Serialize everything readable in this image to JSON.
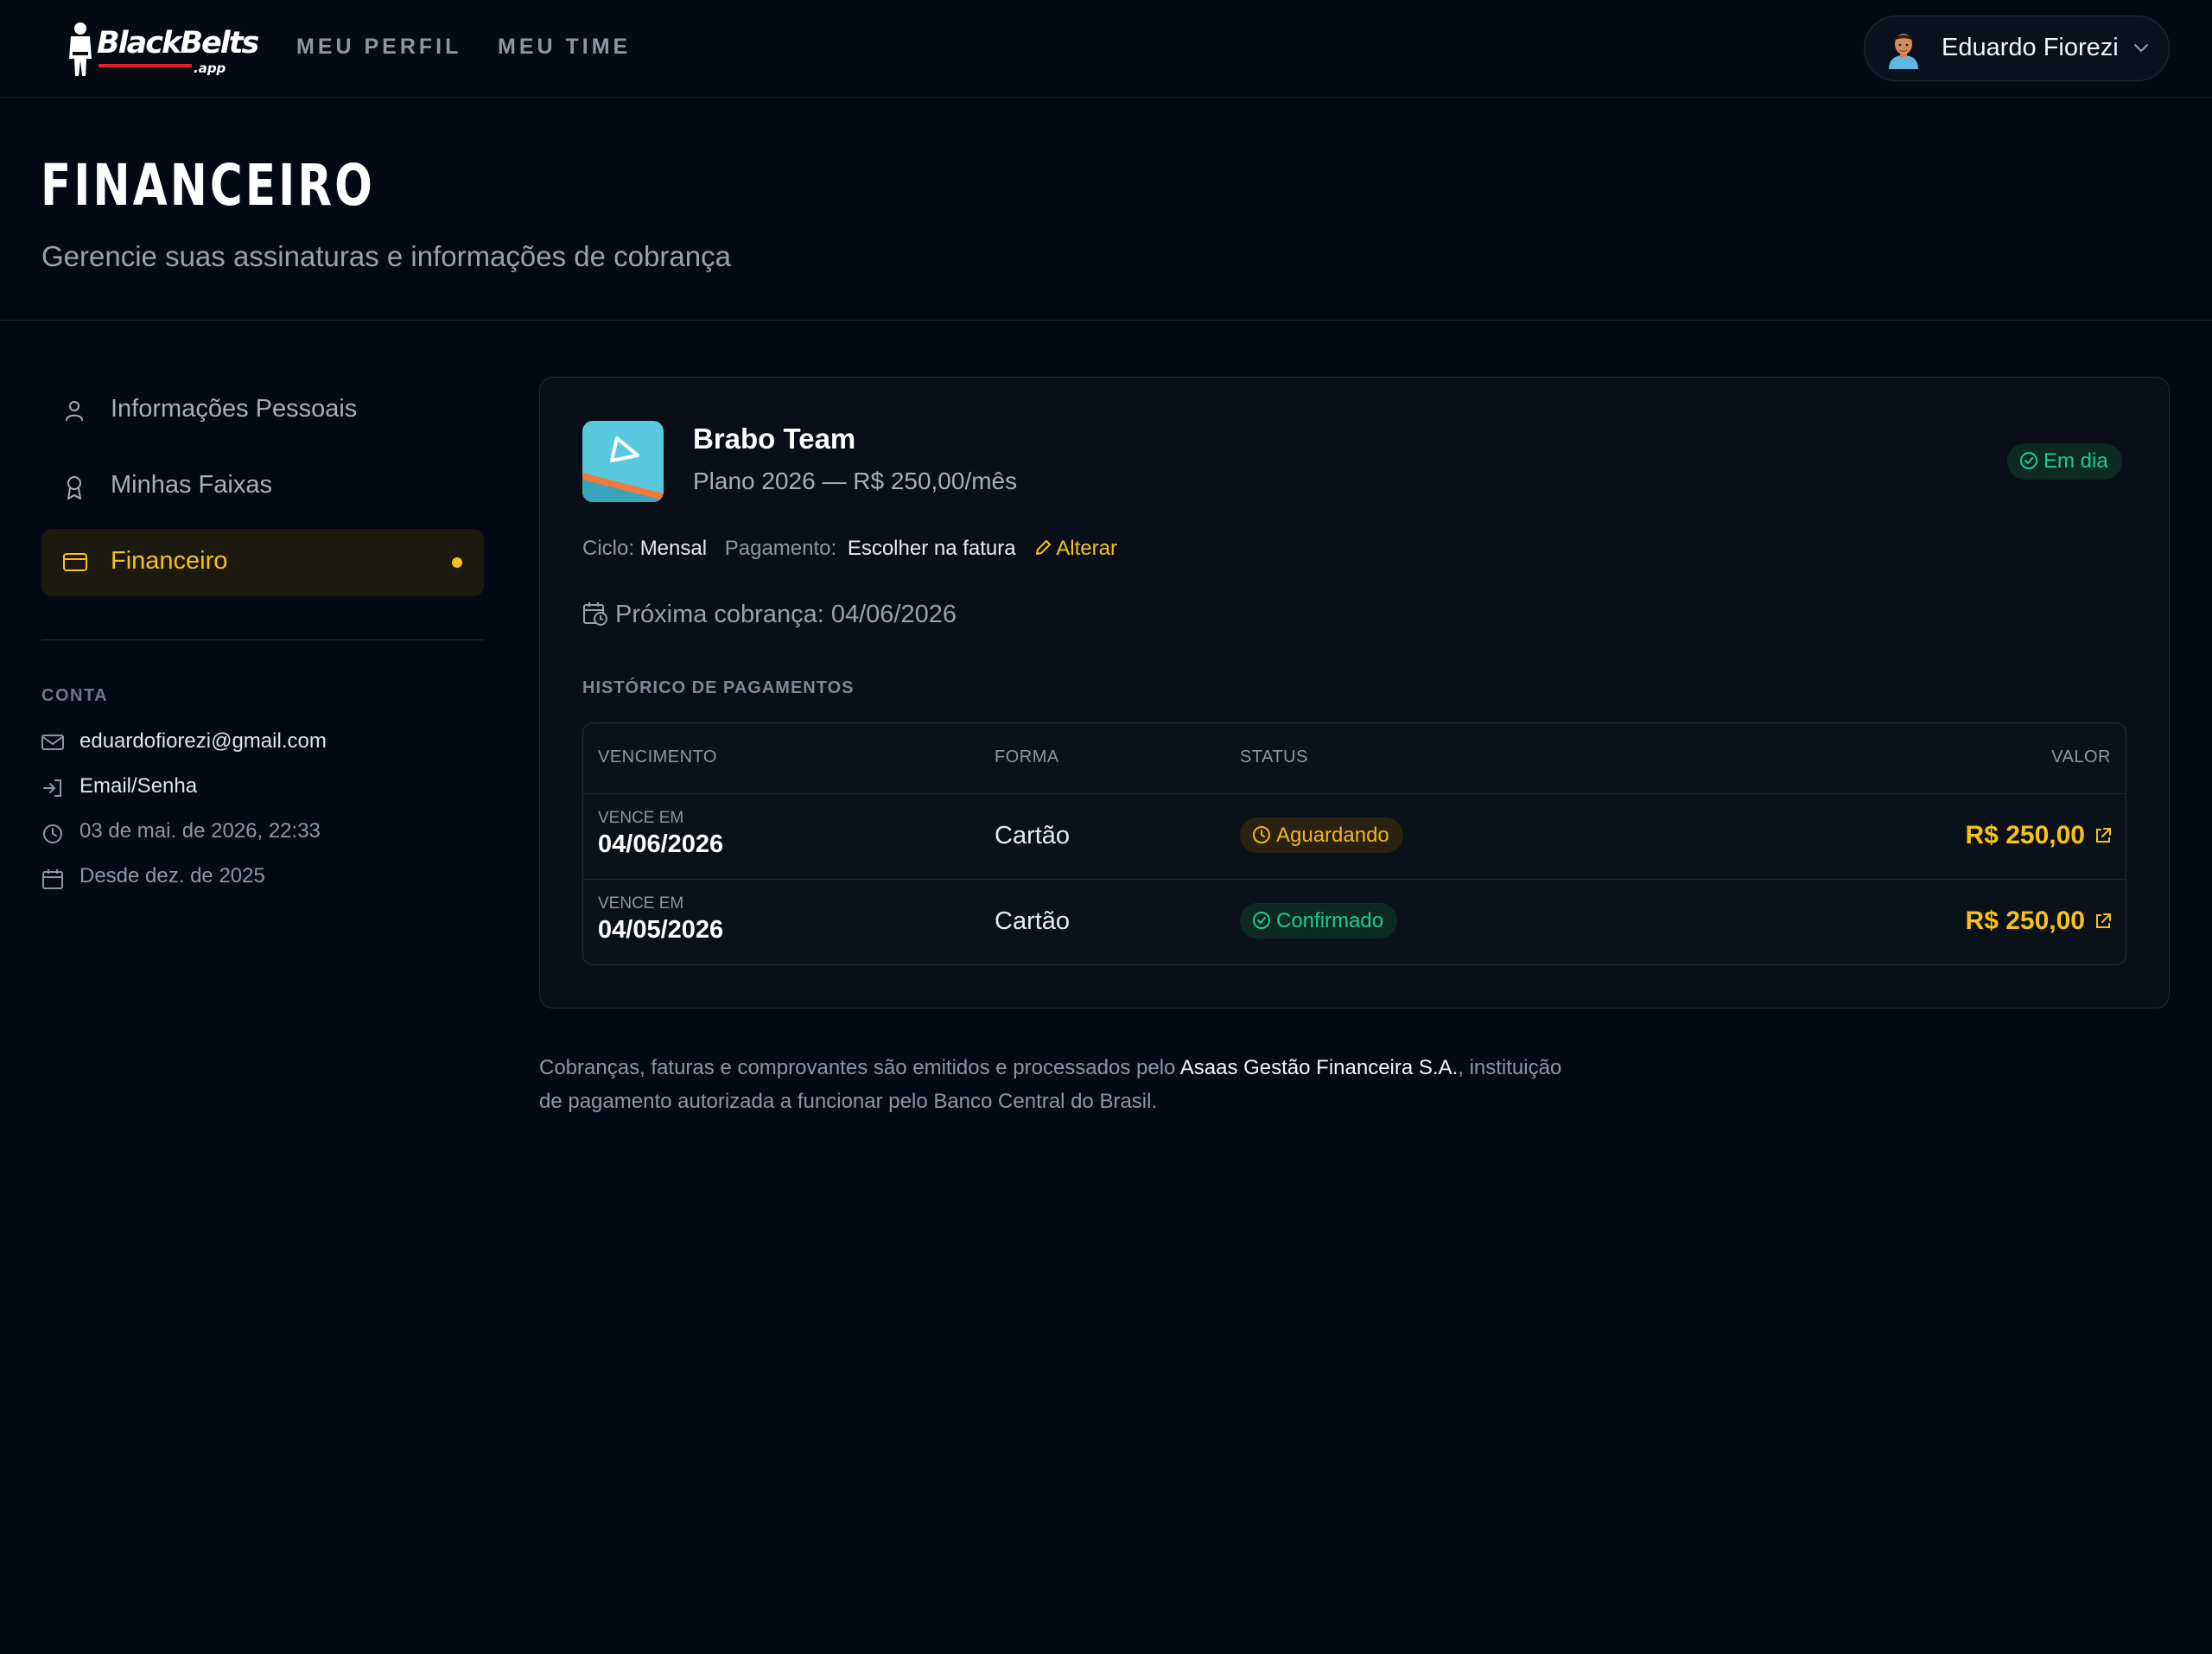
{
  "nav": {
    "logo_text": "BlackBelts",
    "logo_suffix": ".app",
    "links": [
      "MEU PERFIL",
      "MEU TIME"
    ],
    "user_name": "Eduardo Fiorezi"
  },
  "header": {
    "title": "FINANCEIRO",
    "subtitle": "Gerencie suas assinaturas e informações de cobrança"
  },
  "sidebar": {
    "items": [
      {
        "label": "Informações Pessoais",
        "icon": "user-icon"
      },
      {
        "label": "Minhas Faixas",
        "icon": "medal-icon"
      },
      {
        "label": "Financeiro",
        "icon": "credit-card-icon",
        "active": true
      }
    ],
    "account": {
      "heading": "CONTA",
      "email": "eduardofiorezi@gmail.com",
      "auth_method": "Email/Senha",
      "last_access": "03 de mai. de 2026, 22:33",
      "member_since": "Desde dez. de 2025"
    }
  },
  "subscription": {
    "team_name": "Brabo Team",
    "plan": "Plano 2026 — R$ 250,00/mês",
    "status": "Em dia",
    "cycle_label": "Ciclo:",
    "cycle_value": "Mensal",
    "payment_label": "Pagamento:",
    "payment_value": "Escolher na fatura",
    "edit_label": "Alterar",
    "next_billing": "Próxima cobrança: 04/06/2026",
    "history_heading": "HISTÓRICO DE PAGAMENTOS",
    "columns": [
      "VENCIMENTO",
      "FORMA",
      "STATUS",
      "VALOR"
    ],
    "payments": [
      {
        "due_caption": "VENCE EM",
        "due_date": "04/06/2026",
        "method": "Cartão",
        "status": "Aguardando",
        "amount": "R$ 250,00"
      },
      {
        "due_caption": "VENCE EM",
        "due_date": "04/05/2026",
        "method": "Cartão",
        "status": "Confirmado",
        "amount": "R$ 250,00"
      }
    ]
  },
  "footnote": {
    "before": "Cobranças, faturas e comprovantes são emitidos e processados pelo ",
    "company": "Asaas Gestão Financeira S.A.",
    "after": ", instituição de pagamento autorizada a funcionar pelo Banco Central do Brasil."
  },
  "colors": {
    "accent": "#f6c21a",
    "success": "#1fc98e",
    "background": "#050913",
    "card": "#0a0f17"
  }
}
